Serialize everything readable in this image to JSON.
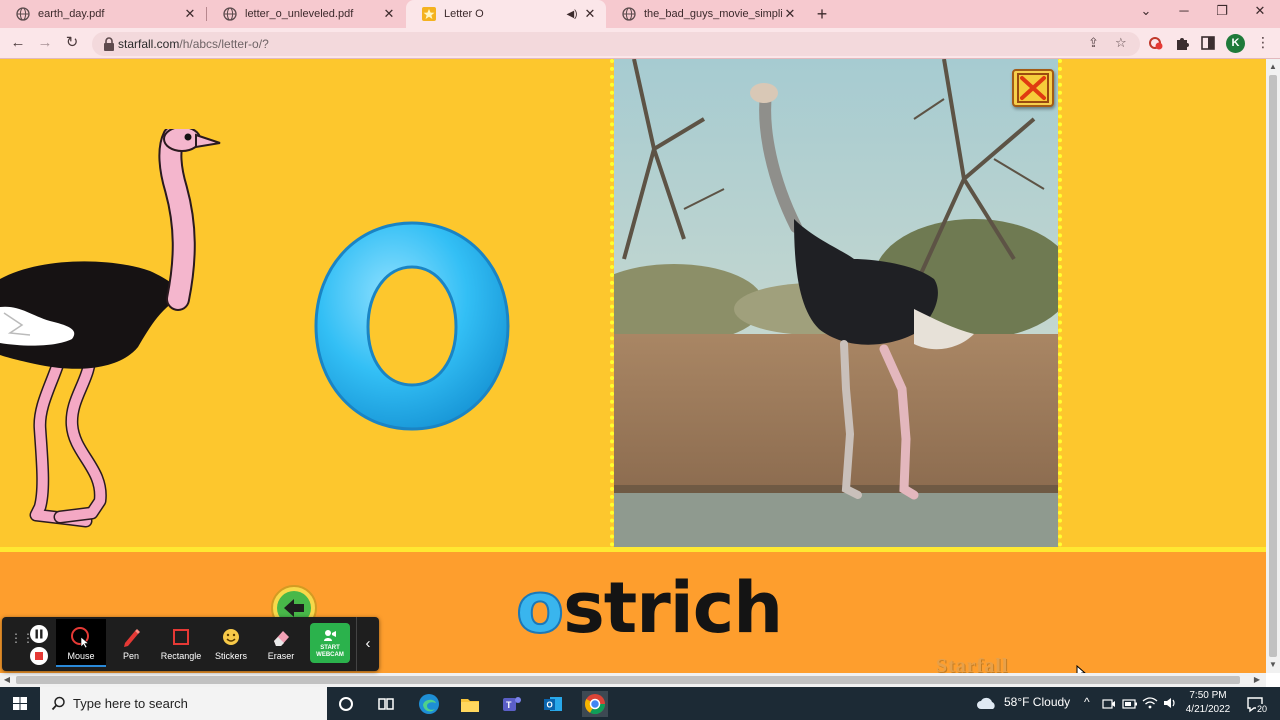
{
  "browser": {
    "tabs": [
      {
        "title": "earth_day.pdf",
        "active": false
      },
      {
        "title": "letter_o_unleveled.pdf",
        "active": false
      },
      {
        "title": "Letter O",
        "active": true
      },
      {
        "title": "the_bad_guys_movie_simplified.p",
        "active": false
      }
    ],
    "new_tab": "+",
    "url_host": "starfall.com",
    "url_path": "/h/abcs/letter-o/?",
    "profile_initial": "K"
  },
  "page": {
    "word_first_letter": "o",
    "word_rest": "strich",
    "brand": "Starfall"
  },
  "annotation_toolbar": {
    "tools": [
      {
        "label": "Mouse",
        "selected": true,
        "icon": "mouse-icon"
      },
      {
        "label": "Pen",
        "selected": false,
        "icon": "pen-icon"
      },
      {
        "label": "Rectangle",
        "selected": false,
        "icon": "rectangle-icon"
      },
      {
        "label": "Stickers",
        "selected": false,
        "icon": "sticker-icon"
      },
      {
        "label": "Eraser",
        "selected": false,
        "icon": "eraser-icon"
      }
    ],
    "webcam_line1": "START",
    "webcam_line2": "WEBCAM"
  },
  "taskbar": {
    "search_placeholder": "Type here to search",
    "weather": "58°F  Cloudy",
    "time": "7:50 PM",
    "date": "4/21/2022",
    "notification_count": "20"
  },
  "colors": {
    "page_yellow": "#fdc72d",
    "band_orange": "#fe9e2d",
    "letter_blue": "#39b5ee",
    "tabstrip_pink": "#f6c9cf"
  }
}
